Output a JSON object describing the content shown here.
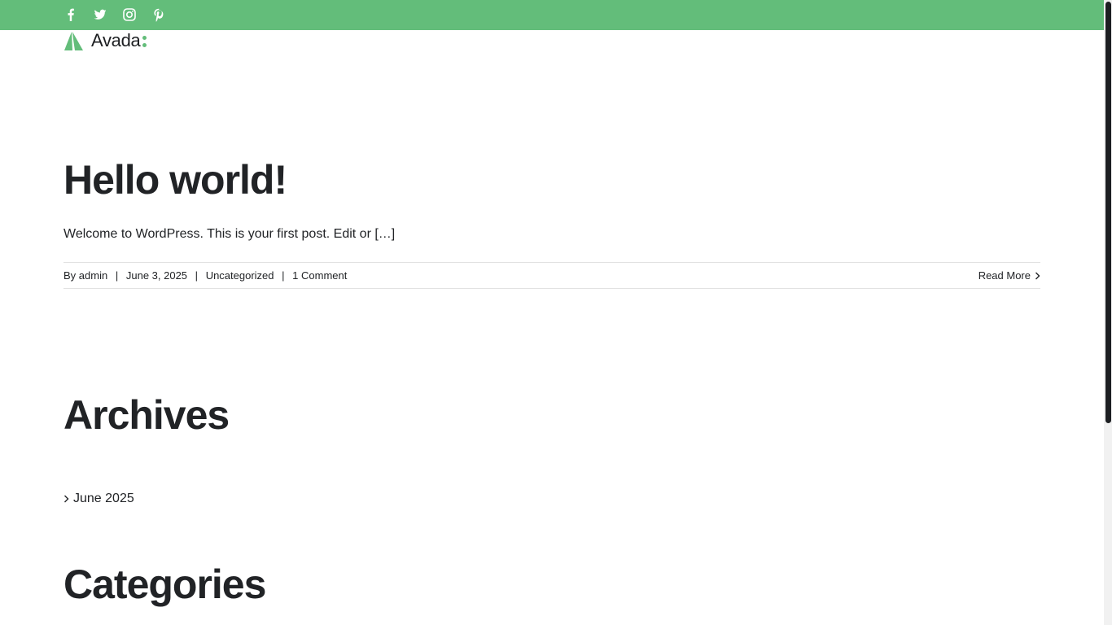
{
  "colors": {
    "topbar": "#63bd7a",
    "accent": "#63bd7a",
    "text": "#212326",
    "divider": "#e2e2e2"
  },
  "topbar": {
    "social_icons": [
      "facebook-icon",
      "twitter-icon",
      "instagram-icon",
      "pinterest-icon"
    ]
  },
  "logo": {
    "text": "Avada"
  },
  "post": {
    "title": "Hello world!",
    "excerpt": "Welcome to WordPress. This is your first post. Edit or […]",
    "meta": {
      "by_label": "By",
      "author": "admin",
      "date": "June 3, 2025",
      "category": "Uncategorized",
      "comments": "1 Comment",
      "separator": "|"
    },
    "read_more": "Read More"
  },
  "sidebar": {
    "archives": {
      "title": "Archives",
      "items": [
        "June 2025"
      ]
    },
    "categories": {
      "title": "Categories"
    }
  }
}
